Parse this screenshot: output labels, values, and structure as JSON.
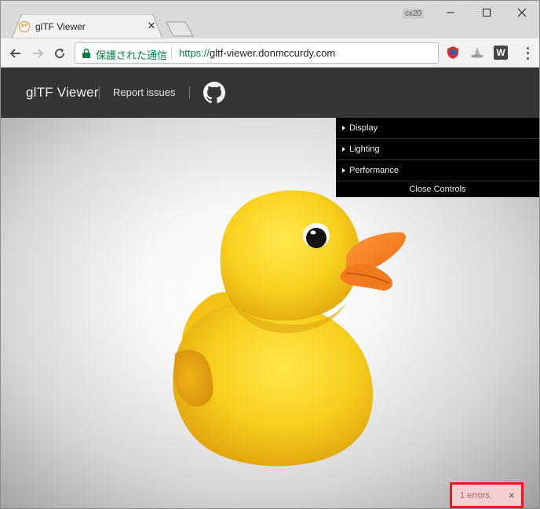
{
  "browser": {
    "tab_title": "glTF Viewer",
    "tab_favicon": "gltf",
    "profile_badge": "cx20",
    "secure_label": "保護された通信",
    "url_scheme": "https://",
    "url_host": "gltf-viewer.donmccurdy.com",
    "ext_w_label": "W"
  },
  "app": {
    "title": "glTF Viewer",
    "report_label": "Report issues"
  },
  "controls": {
    "folders": [
      "Display",
      "Lighting",
      "Performance"
    ],
    "close_label": "Close Controls"
  },
  "error": {
    "message": "1 errors.",
    "close": "×"
  },
  "colors": {
    "header": "#353535",
    "duck_body": "#f5c518",
    "duck_beak": "#f07a1e",
    "error_border": "#e01b24"
  }
}
